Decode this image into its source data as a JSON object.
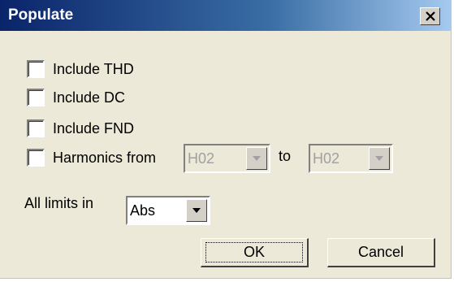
{
  "dialog": {
    "title": "Populate",
    "close_icon": "close-x-icon"
  },
  "options": [
    {
      "label": "Include THD",
      "checked": false
    },
    {
      "label": "Include DC",
      "checked": false
    },
    {
      "label": "Include FND",
      "checked": false
    },
    {
      "label": "Harmonics from",
      "checked": false
    }
  ],
  "harmonics": {
    "from_value": "H02",
    "to_label": "to",
    "to_value": "H02",
    "enabled": false
  },
  "limits": {
    "label": "All limits in",
    "value": "Abs"
  },
  "buttons": {
    "ok": "OK",
    "cancel": "Cancel"
  }
}
